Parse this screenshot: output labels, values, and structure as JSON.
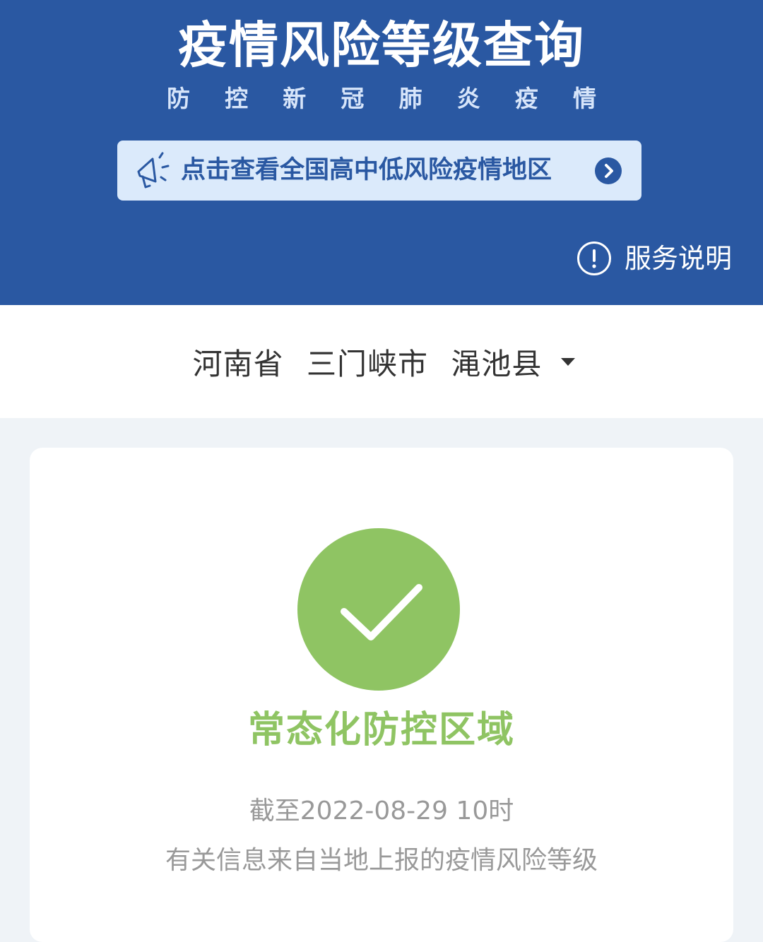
{
  "header": {
    "title": "疫情风险等级查询",
    "subtitle_chars": [
      "防",
      "控",
      "新",
      "冠",
      "肺",
      "炎",
      "疫",
      "情"
    ],
    "banner_text": "点击查看全国高中低风险疫情地区",
    "service_label": "服务说明",
    "bg_color": "#2a58a2"
  },
  "location": {
    "province": "河南省",
    "city": "三门峡市",
    "county": "渑池县",
    "dropdown_icon": "caret-down-icon"
  },
  "result": {
    "icon": "check-circle-icon",
    "status": "常态化防控区域",
    "status_color": "#8fc463",
    "as_of": "截至2022-08-29 10时",
    "note": "有关信息来自当地上报的疫情风险等级"
  }
}
